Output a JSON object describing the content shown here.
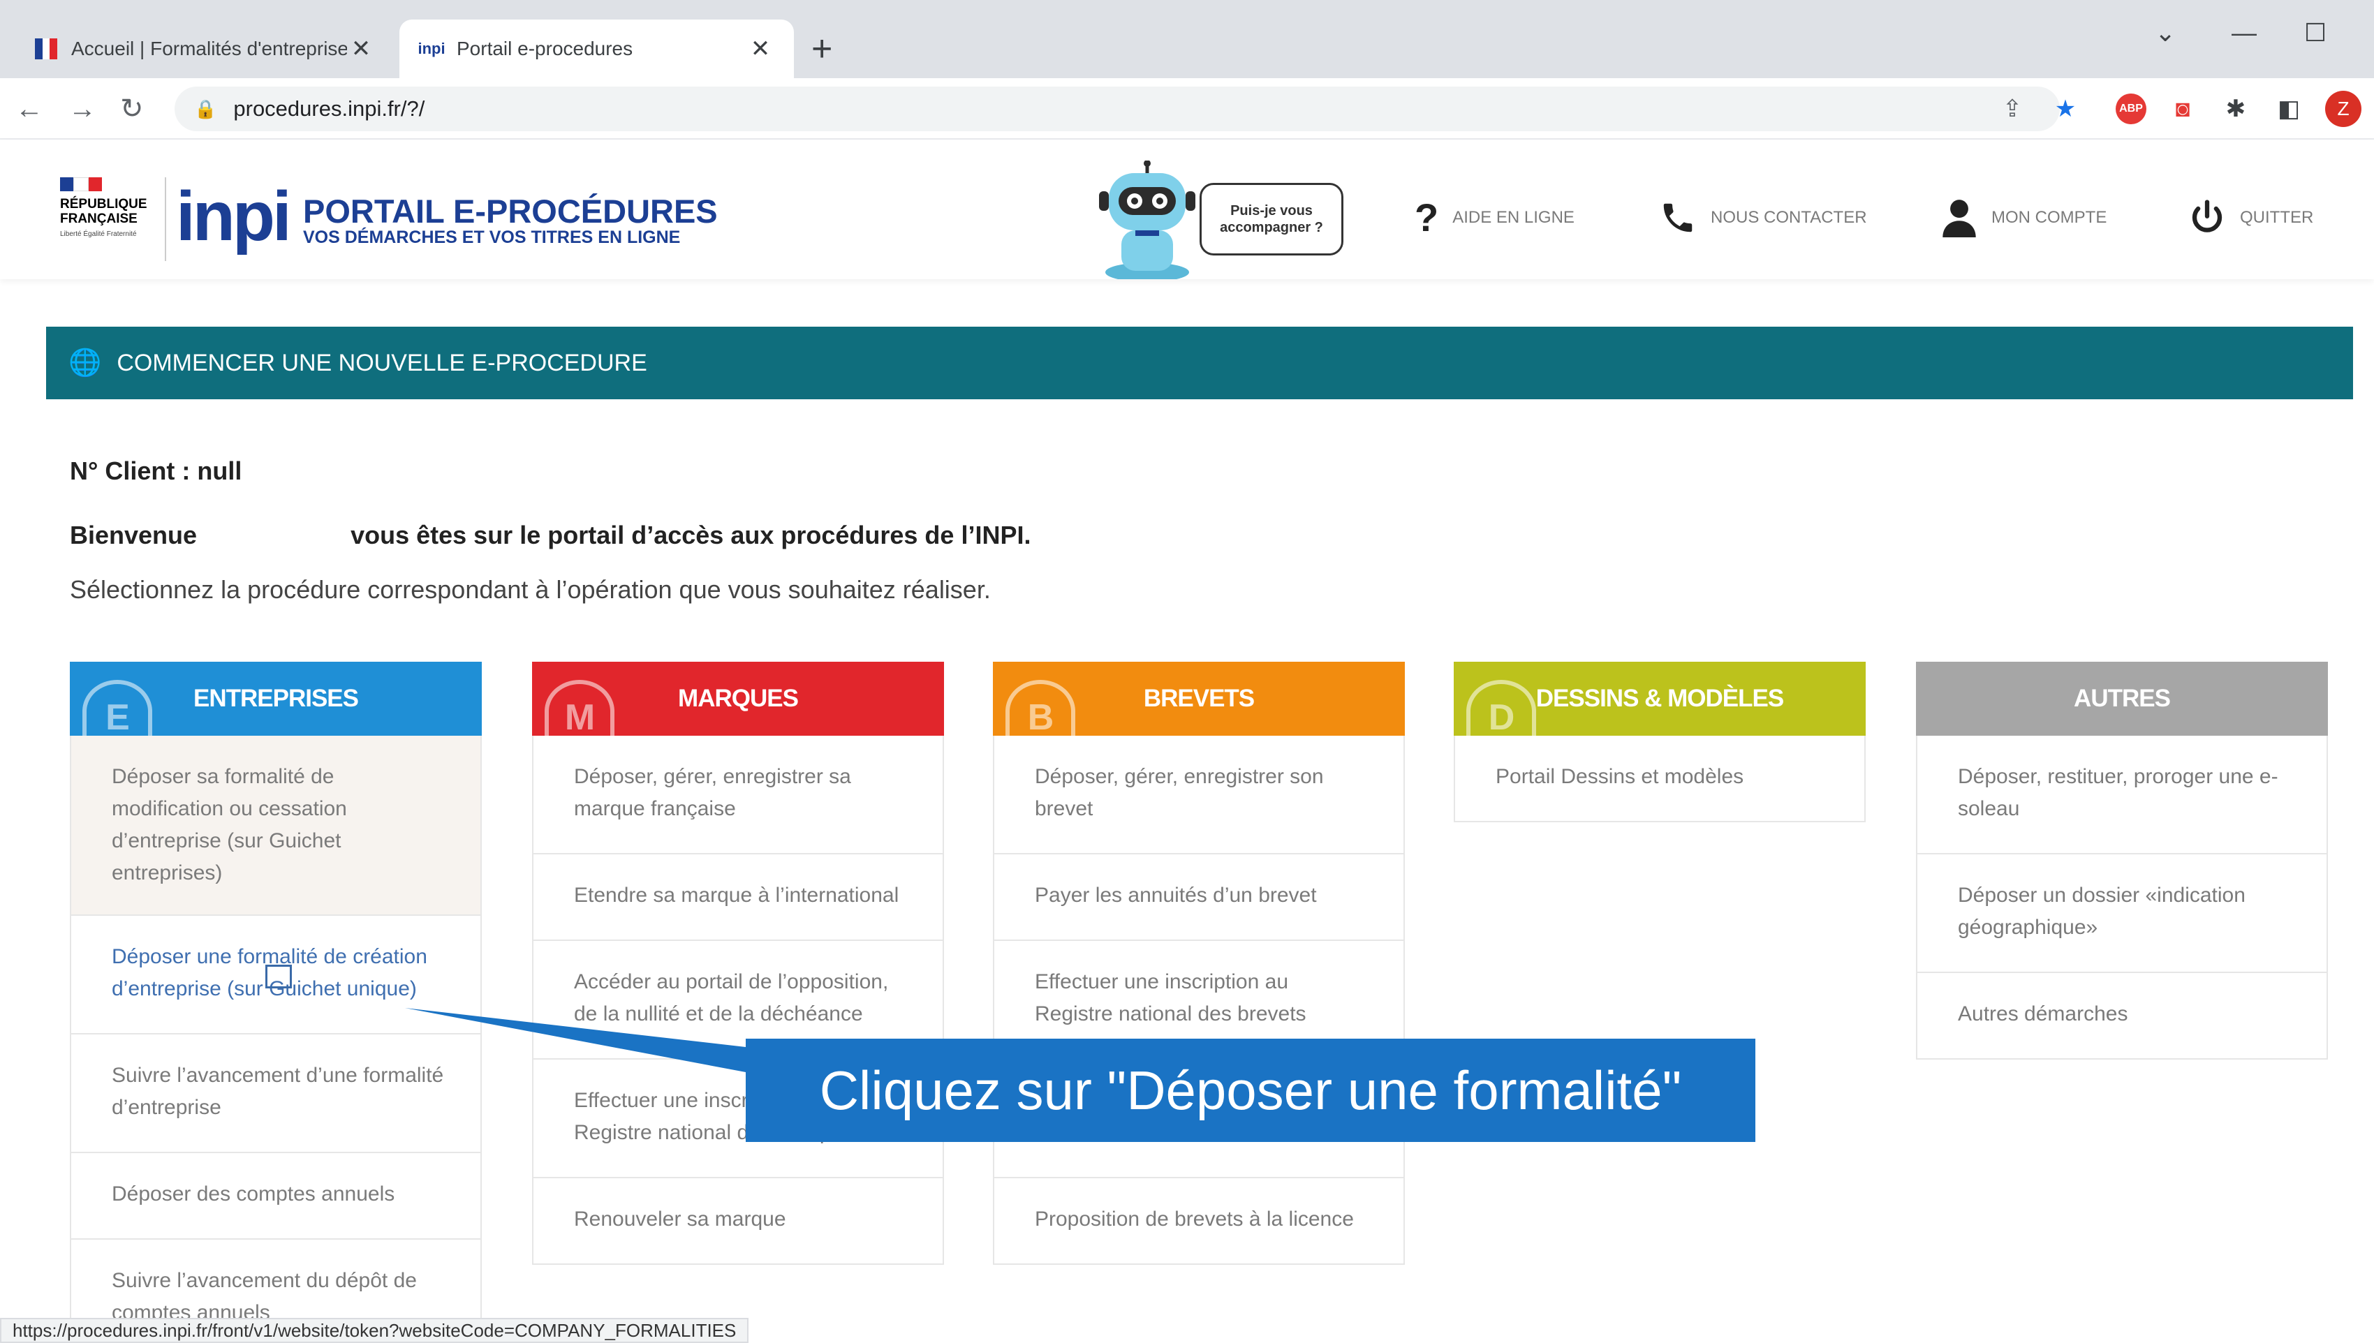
{
  "browser": {
    "tabs": [
      {
        "title": "Accueil | Formalités d'entreprises",
        "active": false
      },
      {
        "title": "Portail e-procedures",
        "active": true
      }
    ],
    "url": "procedures.inpi.fr/?/",
    "status_url": "https://procedures.inpi.fr/front/v1/website/token?websiteCode=COMPANY_FORMALITIES",
    "avatar_letter": "Z",
    "extension_badge": "ABP"
  },
  "header": {
    "rf_logo": "RÉPUBLIQUE FRANÇAISE",
    "rf_motto": "Liberté Égalité Fraternité",
    "inpi_logo": "inpi",
    "portal_title": "PORTAIL E-PROCÉDURES",
    "portal_subtitle": "VOS DÉMARCHES ET VOS TITRES EN LIGNE",
    "assistant_bubble": "Puis-je vous accompagner ?",
    "links": {
      "help": "AIDE EN LIGNE",
      "contact": "NOUS CONTACTER",
      "account": "MON COMPTE",
      "quit": "QUITTER"
    }
  },
  "main": {
    "banner": "COMMENCER UNE NOUVELLE E-PROCEDURE",
    "client_line": "N° Client : null",
    "welcome_prefix": "Bienvenue",
    "welcome_suffix": "vous êtes sur le portail d’accès aux procédures de l’INPI.",
    "select_line": "Sélectionnez la procédure correspondant à l’opération que vous souhaitez réaliser."
  },
  "columns": {
    "entreprises": {
      "title": "ENTREPRISES",
      "letter": "E",
      "color": "#1f8fd6",
      "items": [
        "Déposer sa formalité de modification ou cessation d’entreprise (sur Guichet entreprises)",
        "Déposer une formalité de création d’entreprise (sur Guichet unique)",
        "Suivre l’avancement d’une formalité d’entreprise",
        "Déposer des comptes annuels",
        "Suivre l’avancement du dépôt de comptes annuels"
      ]
    },
    "marques": {
      "title": "MARQUES",
      "letter": "M",
      "color": "#e1262c",
      "items": [
        "Déposer, gérer, enregistrer sa marque française",
        "Etendre sa marque à l’international",
        "Accéder au portail de l’opposition, de la nullité et de la déchéance",
        "Effectuer une inscription au Registre national des marques",
        "Renouveler sa marque"
      ]
    },
    "brevets": {
      "title": "BREVETS",
      "letter": "B",
      "color": "#f28c0f",
      "items": [
        "Déposer, gérer, enregistrer son brevet",
        "Payer les annuités d’un brevet",
        "Effectuer une inscription au Registre national des brevets",
        "",
        "Proposition de brevets à la licence"
      ]
    },
    "dessins": {
      "title": "DESSINS & MODÈLES",
      "letter": "D",
      "color": "#bcc21c",
      "items": [
        "Portail Dessins et modèles"
      ]
    },
    "autres": {
      "title": "AUTRES",
      "letter": "",
      "color": "#a6a6a6",
      "items": [
        "Déposer, restituer, proroger une e-soleau",
        "Déposer un dossier «indication géographique»",
        "Autres démarches"
      ]
    }
  },
  "callout": {
    "text": "Cliquez sur \"Déposer une formalité\""
  }
}
